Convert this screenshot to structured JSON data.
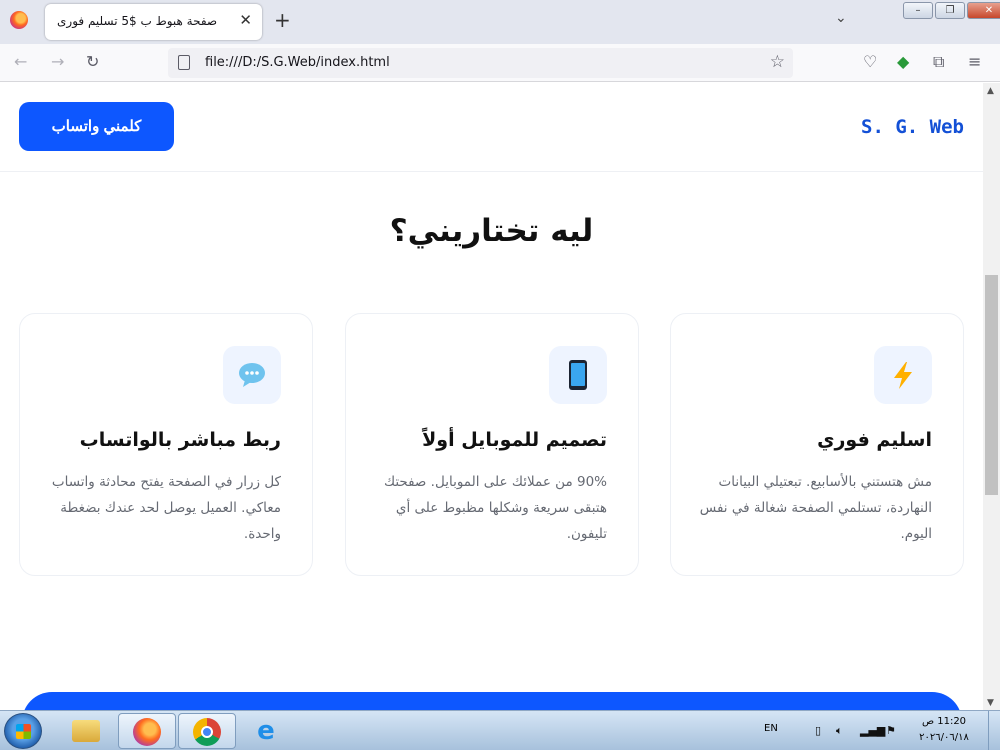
{
  "browser": {
    "tab_title": "صفحة هبوط ب $5 تسليم فورى",
    "tab_close": "✕",
    "new_tab": "+",
    "url": "file:///D:/S.G.Web/index.html"
  },
  "site": {
    "logo": "S. G. Web",
    "cta_label": "كلمني واتساب",
    "section_title": "ليه تختاريني؟",
    "features": [
      {
        "icon": "lightning-icon",
        "title": "اسليم فوري",
        "desc": "مش هتستني بالأسابيع. تبعتيلي البيانات النهاردة، تستلمي الصفحة شغالة في نفس اليوم."
      },
      {
        "icon": "mobile-phone-icon",
        "title": "تصميم للموبايل أولاً",
        "desc": "90% من عملائك على الموبايل. صفحتك هتبقى سريعة وشكلها مظبوط على أي تليفون."
      },
      {
        "icon": "speech-bubble-icon",
        "title": "ربط مباشر بالواتساب",
        "desc": "كل زرار في الصفحة يفتح محادثة واتساب معاكي. العميل يوصل لحد عندك بضغطة واحدة."
      }
    ]
  },
  "taskbar": {
    "language": "EN",
    "time": "11:20 ص",
    "date": "٢٠٢٦/٠٦/١٨"
  },
  "colors": {
    "brand_blue": "#0d57ff",
    "logo_blue": "#1350d6",
    "icon_bg": "#eef4ff"
  }
}
